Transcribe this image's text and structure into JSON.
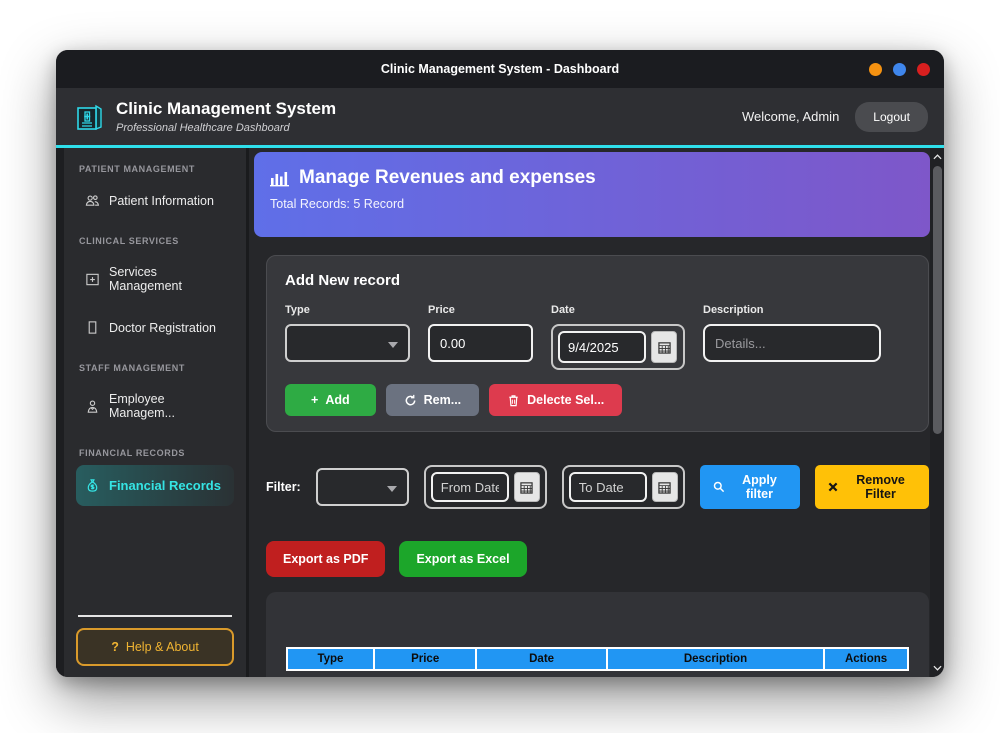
{
  "window": {
    "title": "Clinic Management System - Dashboard"
  },
  "header": {
    "app_title": "Clinic Management System",
    "app_subtitle": "Professional Healthcare Dashboard",
    "welcome": "Welcome, Admin",
    "logout_label": "Logout",
    "logo_icon": "hospital-logo-icon"
  },
  "sidebar": {
    "sections": [
      {
        "label": "PATIENT MANAGEMENT",
        "items": [
          {
            "label": "Patient Information",
            "icon": "patients-icon"
          }
        ]
      },
      {
        "label": "CLINICAL SERVICES",
        "items": [
          {
            "label": "Services Management",
            "icon": "hospital-icon"
          },
          {
            "label": "Doctor Registration",
            "icon": "doctor-icon"
          }
        ]
      },
      {
        "label": "STAFF MANAGEMENT",
        "items": [
          {
            "label": "Employee Managem...",
            "icon": "employee-icon"
          }
        ]
      },
      {
        "label": "FINANCIAL RECORDS",
        "items": [
          {
            "label": "Financial Records",
            "icon": "money-icon",
            "active": true
          }
        ]
      }
    ],
    "help": {
      "icon": "?",
      "label": "Help & About"
    }
  },
  "banner": {
    "icon": "bar-chart-icon",
    "title": "Manage Revenues and expenses",
    "subtitle": "Total Records: 5 Record"
  },
  "add_form": {
    "title": "Add New record",
    "type": {
      "label": "Type"
    },
    "price": {
      "label": "Price",
      "value": "0.00"
    },
    "date": {
      "label": "Date",
      "value": "9/4/2025"
    },
    "description": {
      "label": "Description",
      "placeholder": "Details..."
    },
    "buttons": {
      "add_label": "Add",
      "remove_label": "Rem...",
      "delete_label": "Delecte Sel..."
    }
  },
  "filter": {
    "label": "Filter:",
    "from_placeholder": "From Date",
    "to_placeholder": "To Date",
    "apply_label": "Apply filter",
    "remove_label": "Remove Filter"
  },
  "export": {
    "pdf_label": "Export as PDF",
    "excel_label": "Export as Excel"
  },
  "table": {
    "columns": [
      "Type",
      "Price",
      "Date",
      "Description",
      "Actions"
    ]
  },
  "colors": {
    "accent_cyan": "#2fe0ec",
    "banner_gradient_from": "#5f6fe8",
    "banner_gradient_to": "#7e57c9",
    "table_header_blue": "#2196f3",
    "add_green": "#2eab44",
    "delete_red": "#dd3b4e",
    "neutral_gray": "#6b7280",
    "apply_blue": "#2196f3",
    "remove_yellow": "#ffc107",
    "export_pdf_red": "#c01f1f",
    "export_excel_green": "#1ca62a",
    "help_orange": "#f0b432",
    "traffic_orange": "#f59211",
    "traffic_blue": "#3f86ec",
    "traffic_red": "#d81f1f"
  }
}
